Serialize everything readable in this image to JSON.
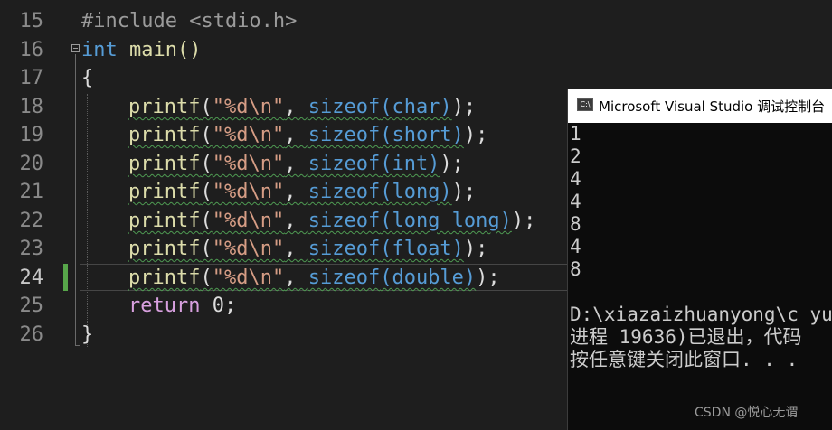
{
  "editor": {
    "lines": [
      {
        "number": "15",
        "text": "#include <stdio.h>"
      },
      {
        "number": "16",
        "t1": "int",
        "t2": " main()"
      },
      {
        "number": "17",
        "text": "{"
      },
      {
        "number": "18",
        "fn": "printf",
        "open": "(",
        "str": "\"%d\\n\"",
        "comma": ", ",
        "kw": "sizeof",
        "arg": "(char)",
        "close": ");"
      },
      {
        "number": "19",
        "fn": "printf",
        "open": "(",
        "str": "\"%d\\n\"",
        "comma": ", ",
        "kw": "sizeof",
        "arg": "(short)",
        "close": ");"
      },
      {
        "number": "20",
        "fn": "printf",
        "open": "(",
        "str": "\"%d\\n\"",
        "comma": ", ",
        "kw": "sizeof",
        "arg": "(int)",
        "close": ");"
      },
      {
        "number": "21",
        "fn": "printf",
        "open": "(",
        "str": "\"%d\\n\"",
        "comma": ", ",
        "kw": "sizeof",
        "arg": "(long)",
        "close": ");"
      },
      {
        "number": "22",
        "fn": "printf",
        "open": "(",
        "str": "\"%d\\n\"",
        "comma": ", ",
        "kw": "sizeof",
        "arg": "(long long)",
        "close": ");"
      },
      {
        "number": "23",
        "fn": "printf",
        "open": "(",
        "str": "\"%d\\n\"",
        "comma": ", ",
        "kw": "sizeof",
        "arg": "(float)",
        "close": ");"
      },
      {
        "number": "24",
        "fn": "printf",
        "open": "(",
        "str": "\"%d\\n\"",
        "comma": ", ",
        "kw": "sizeof",
        "arg": "(double)",
        "close": ");"
      },
      {
        "number": "25",
        "kw": "return",
        "rest": " 0;"
      },
      {
        "number": "26",
        "text": "}"
      }
    ]
  },
  "console": {
    "icon_text": "C:\\",
    "title": "Microsoft Visual Studio 调试控制台",
    "output": [
      "1",
      "2",
      "4",
      "4",
      "8",
      "4",
      "8"
    ],
    "path_line": "D:\\xiazaizhuanyong\\c yu",
    "exit_line": "进程 19636)已退出，代码",
    "press_key_line": "按任意键关闭此窗口. . ."
  },
  "watermark": "CSDN @悦心无谓",
  "colors": {
    "background": "#1e1e1e",
    "keyword": "#569cd6",
    "function": "#dcdcaa",
    "string": "#d69d85",
    "change_bar": "#57a64a",
    "console_bg": "#0c0c0c"
  }
}
